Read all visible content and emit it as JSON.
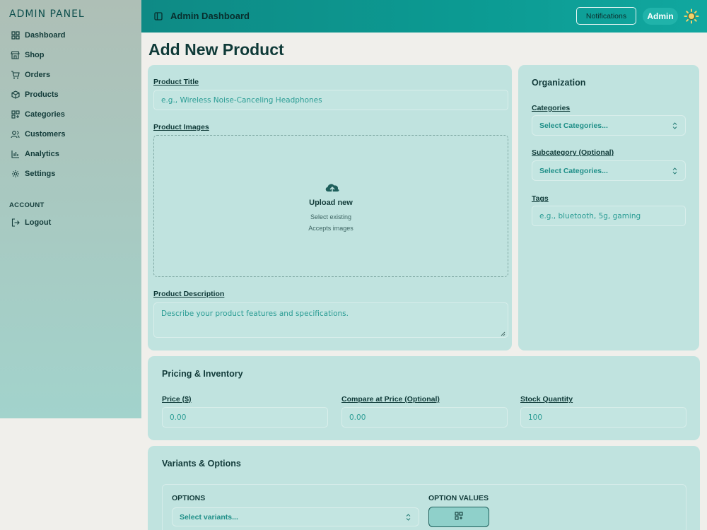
{
  "sidebar": {
    "brand": "ADMIN PANEL",
    "items": [
      {
        "label": "Dashboard",
        "icon": "grid-icon"
      },
      {
        "label": "Shop",
        "icon": "store-icon"
      },
      {
        "label": "Orders",
        "icon": "cart-icon"
      },
      {
        "label": "Products",
        "icon": "box-icon"
      },
      {
        "label": "Categories",
        "icon": "categories-icon"
      },
      {
        "label": "Customers",
        "icon": "users-icon"
      },
      {
        "label": "Analytics",
        "icon": "bar-chart-icon"
      },
      {
        "label": "Settings",
        "icon": "gear-icon"
      }
    ],
    "account_label": "ACCOUNT",
    "logout_label": "Logout"
  },
  "header": {
    "title": "Admin Dashboard",
    "notifications_label": "Notifications",
    "user_label": "Admin"
  },
  "page": {
    "title": "Add New Product"
  },
  "product": {
    "title_label": "Product Title",
    "title_placeholder": "e.g., Wireless Noise-Canceling Headphones",
    "images_label": "Product Images",
    "upload_label": "Upload new",
    "select_existing": "Select existing",
    "accepts": "Accepts images",
    "description_label": "Product Description",
    "description_placeholder": "Describe your product features and specifications."
  },
  "organization": {
    "title": "Organization",
    "categories_label": "Categories",
    "categories_value": "Select Categories...",
    "subcategory_label": "Subcategory (Optional)",
    "subcategory_value": "Select Categories...",
    "tags_label": "Tags",
    "tags_placeholder": "e.g., bluetooth, 5g, gaming"
  },
  "pricing": {
    "title": "Pricing & Inventory",
    "price_label": "Price ($)",
    "price_value": "0.00",
    "compare_label": "Compare at Price (Optional)",
    "compare_value": "0.00",
    "stock_label": "Stock Quantity",
    "stock_value": "100"
  },
  "variants": {
    "title": "Variants & Options",
    "options_label": "OPTIONS",
    "options_value": "Select variants...",
    "values_label": "OPTION VALUES"
  },
  "colors": {
    "accent": "#0e8a85",
    "card": "#c0e3df",
    "badge": "#20b3aa"
  }
}
